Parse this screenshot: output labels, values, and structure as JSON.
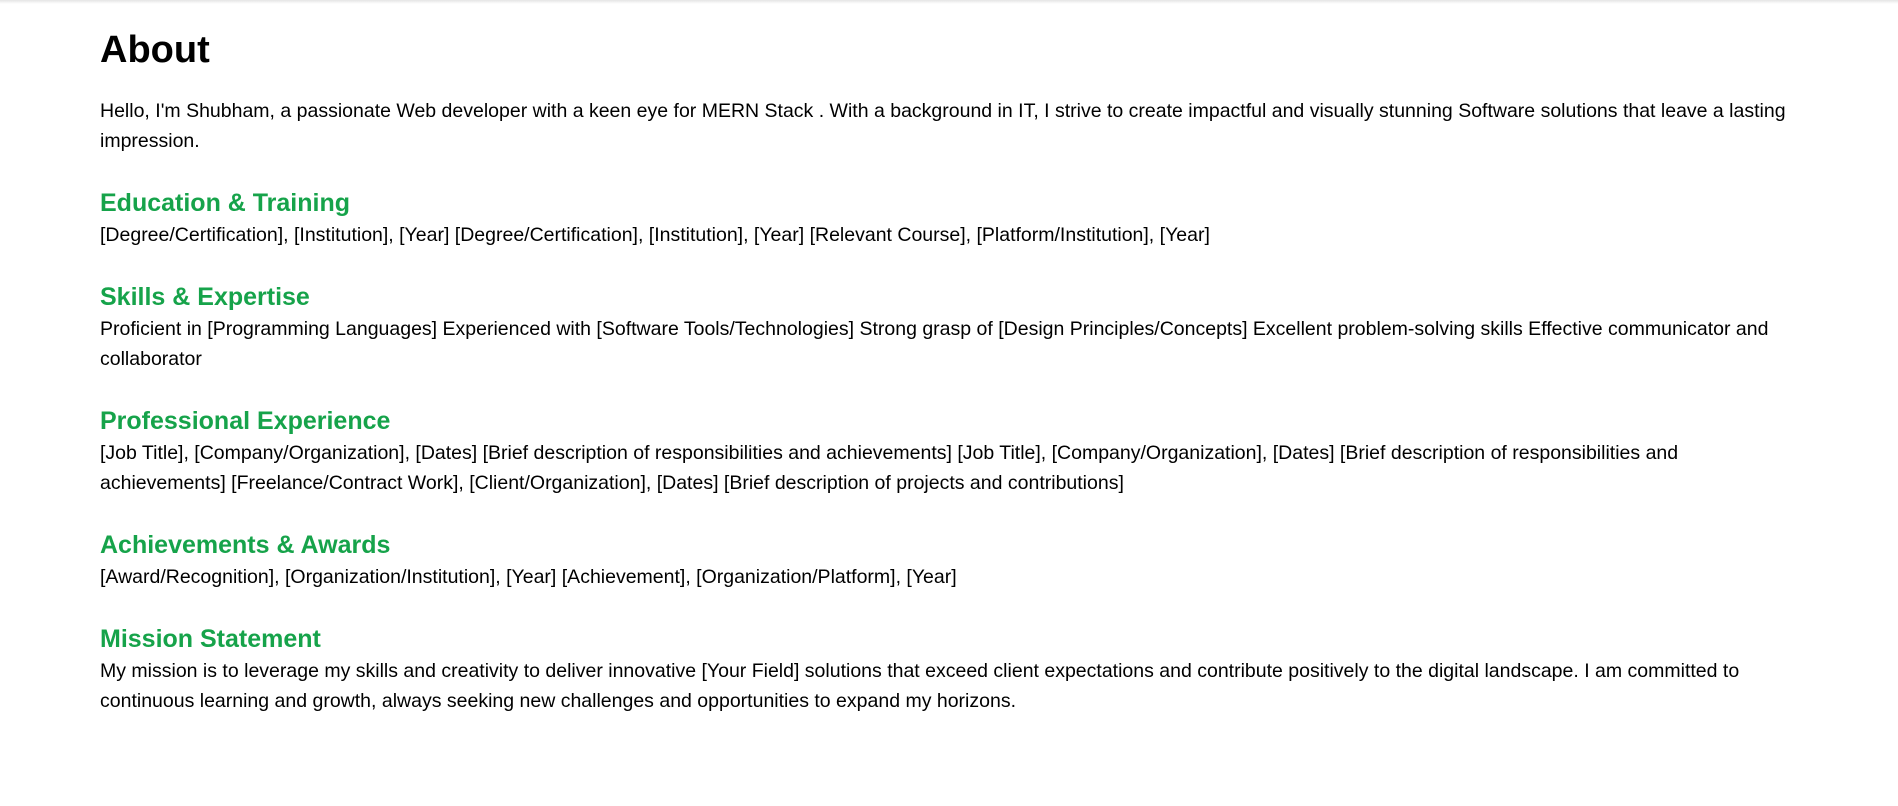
{
  "about": {
    "title": "About",
    "intro": "Hello, I'm Shubham, a passionate Web developer with a keen eye for MERN Stack . With a background in IT, I strive to create impactful and visually stunning Software solutions that leave a lasting impression."
  },
  "sections": [
    {
      "heading": "Education & Training",
      "body": "[Degree/Certification], [Institution], [Year] [Degree/Certification], [Institution], [Year] [Relevant Course], [Platform/Institution], [Year]"
    },
    {
      "heading": "Skills & Expertise",
      "body": "Proficient in [Programming Languages] Experienced with [Software Tools/Technologies] Strong grasp of [Design Principles/Concepts] Excellent problem-solving skills Effective communicator and collaborator"
    },
    {
      "heading": "Professional Experience",
      "body": "[Job Title], [Company/Organization], [Dates] [Brief description of responsibilities and achievements] [Job Title], [Company/Organization], [Dates] [Brief description of responsibilities and achievements] [Freelance/Contract Work], [Client/Organization], [Dates] [Brief description of projects and contributions]"
    },
    {
      "heading": "Achievements & Awards",
      "body": "[Award/Recognition], [Organization/Institution], [Year] [Achievement], [Organization/Platform], [Year]"
    },
    {
      "heading": "Mission Statement",
      "body": "My mission is to leverage my skills and creativity to deliver innovative [Your Field] solutions that exceed client expectations and contribute positively to the digital landscape. I am committed to continuous learning and growth, always seeking new challenges and opportunities to expand my horizons."
    }
  ],
  "colors": {
    "heading_accent": "#16a34a",
    "text": "#000000",
    "background": "#ffffff"
  }
}
